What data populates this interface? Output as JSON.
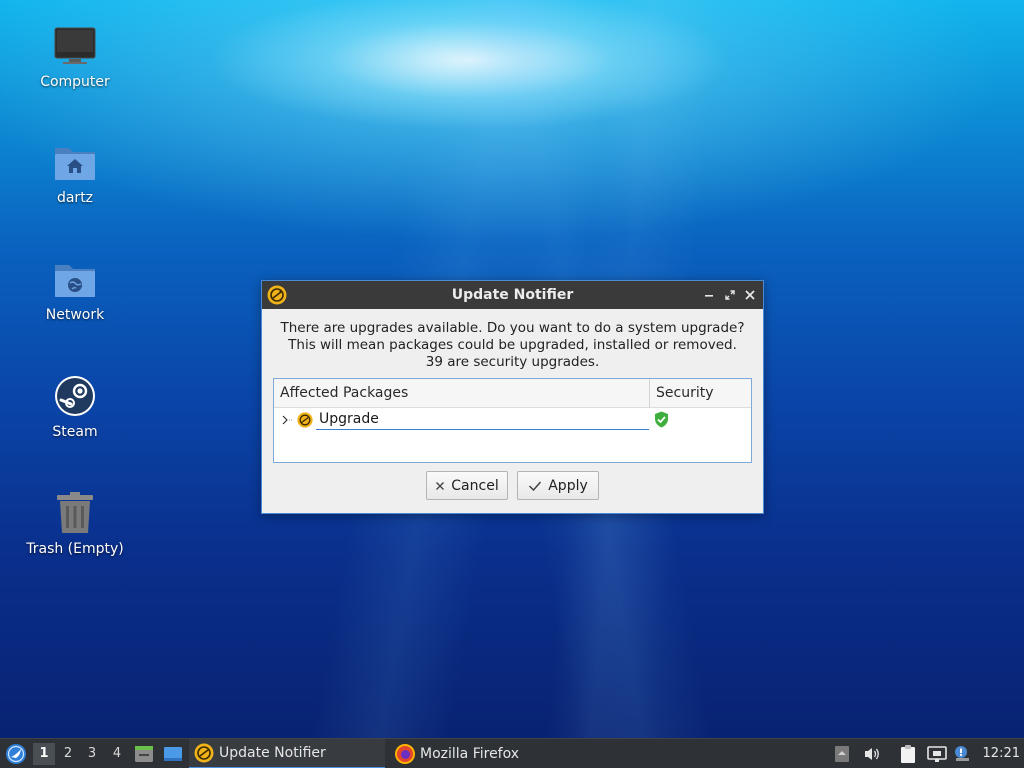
{
  "desktop": {
    "icons": [
      {
        "label": "Computer"
      },
      {
        "label": "dartz"
      },
      {
        "label": "Network"
      },
      {
        "label": "Steam"
      },
      {
        "label": "Trash (Empty)"
      }
    ]
  },
  "dialog": {
    "title": "Update Notifier",
    "message_lines": [
      "There are upgrades available. Do you want to do a system upgrade?",
      "This will mean packages could be upgraded, installed or removed.",
      "39 are security upgrades."
    ],
    "table": {
      "columns": [
        "Affected Packages",
        "Security"
      ],
      "rows": [
        {
          "label": "Upgrade",
          "security": "shield-check-icon"
        }
      ]
    },
    "buttons": {
      "cancel": "Cancel",
      "apply": "Apply"
    }
  },
  "taskbar": {
    "workspaces": [
      "1",
      "2",
      "3",
      "4"
    ],
    "active_workspace": "1",
    "tasks": [
      {
        "label": "Update Notifier",
        "active": true
      },
      {
        "label": "Mozilla Firefox",
        "active": false
      }
    ],
    "clock": "12:21"
  },
  "colors": {
    "accent": "#4c93e6",
    "titlebar": "#3a3a3a",
    "taskbar": "#2e3236",
    "update_icon": "#f0b21a",
    "security_ok": "#3fae3f"
  }
}
